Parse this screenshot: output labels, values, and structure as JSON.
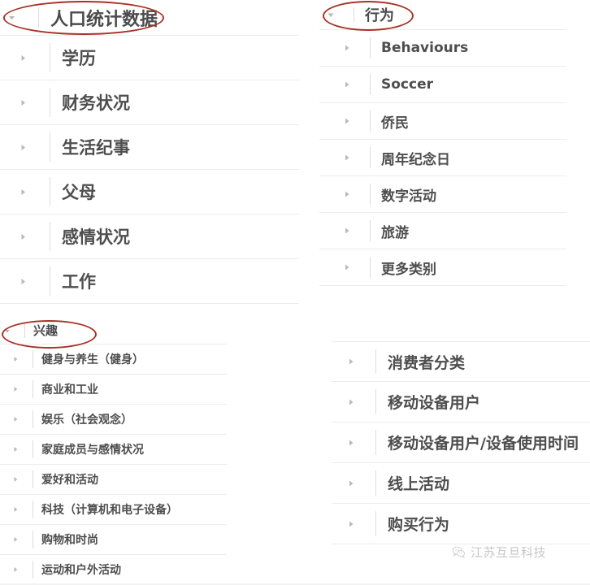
{
  "panels": {
    "demographics": {
      "header": {
        "label": "人口统计数据",
        "caret": "caret-down-icon"
      },
      "rows": [
        {
          "label": "学历",
          "caret": "caret-right-icon"
        },
        {
          "label": "财务状况",
          "caret": "caret-right-icon"
        },
        {
          "label": "生活纪事",
          "caret": "caret-right-icon"
        },
        {
          "label": "父母",
          "caret": "caret-right-icon"
        },
        {
          "label": "感情状况",
          "caret": "caret-right-icon"
        },
        {
          "label": "工作",
          "caret": "caret-right-icon"
        }
      ]
    },
    "behavior": {
      "header": {
        "label": "行为",
        "caret": "caret-down-icon"
      },
      "rows": [
        {
          "label": "Behaviours",
          "caret": "caret-right-icon"
        },
        {
          "label": "Soccer",
          "caret": "caret-right-icon"
        },
        {
          "label": "侨民",
          "caret": "caret-right-icon"
        },
        {
          "label": "周年纪念日",
          "caret": "caret-right-icon"
        },
        {
          "label": "数字活动",
          "caret": "caret-right-icon"
        },
        {
          "label": "旅游",
          "caret": "caret-right-icon"
        },
        {
          "label": "更多类别",
          "caret": "caret-right-icon"
        }
      ]
    },
    "interests": {
      "header": {
        "label": "兴趣",
        "caret": "caret-down-icon"
      },
      "rows": [
        {
          "label": "健身与养生（健身）",
          "caret": "caret-right-icon"
        },
        {
          "label": "商业和工业",
          "caret": "caret-right-icon"
        },
        {
          "label": "娱乐（社会观念）",
          "caret": "caret-right-icon"
        },
        {
          "label": "家庭成员与感情状况",
          "caret": "caret-right-icon"
        },
        {
          "label": "爱好和活动",
          "caret": "caret-right-icon"
        },
        {
          "label": "科技（计算机和电子设备）",
          "caret": "caret-right-icon"
        },
        {
          "label": "购物和时尚",
          "caret": "caret-right-icon"
        },
        {
          "label": "运动和户外活动",
          "caret": "caret-right-icon"
        }
      ]
    },
    "consumer": {
      "rows": [
        {
          "label": "消费者分类",
          "caret": "caret-right-icon"
        },
        {
          "label": "移动设备用户",
          "caret": "caret-right-icon"
        },
        {
          "label": "移动设备用户/设备使用时间",
          "caret": "caret-right-icon"
        },
        {
          "label": "线上活动",
          "caret": "caret-right-icon"
        },
        {
          "label": "购买行为",
          "caret": "caret-right-icon"
        }
      ]
    }
  },
  "annotations": {
    "color": "#a93226",
    "items": [
      {
        "name": "ellipse-around-demographics-header"
      },
      {
        "name": "ellipse-around-behavior-header"
      },
      {
        "name": "ellipse-around-interests-header"
      }
    ]
  },
  "watermark": {
    "text": "江苏互旦科技",
    "logo": "wechat-logo-icon"
  }
}
